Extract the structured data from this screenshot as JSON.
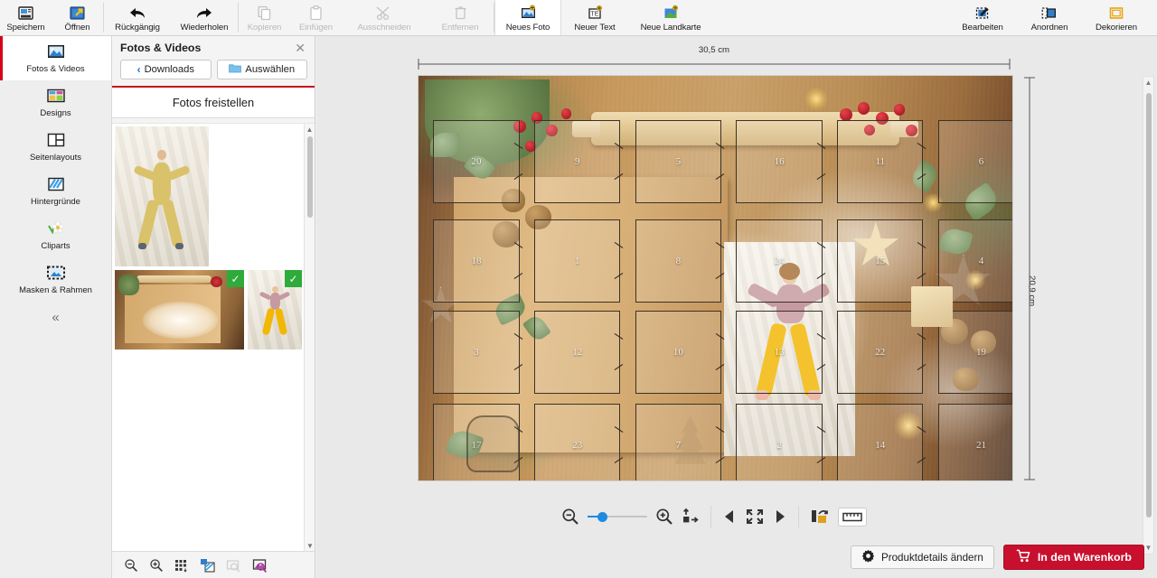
{
  "toolbar": {
    "groups": [
      {
        "items": [
          {
            "label": "Speichern",
            "icon": "save-icon",
            "state": "enabled"
          },
          {
            "label": "Öffnen",
            "icon": "open-folder-icon",
            "state": "enabled"
          }
        ]
      },
      {
        "items": [
          {
            "label": "Rückgängig",
            "icon": "undo-arrow-icon",
            "state": "enabled"
          },
          {
            "label": "Wiederholen",
            "icon": "redo-arrow-icon",
            "state": "enabled"
          }
        ]
      },
      {
        "items": [
          {
            "label": "Kopieren",
            "icon": "copy-icon",
            "state": "disabled"
          },
          {
            "label": "Einfügen",
            "icon": "paste-icon",
            "state": "disabled"
          },
          {
            "label": "Ausschneiden",
            "icon": "scissors-icon",
            "state": "disabled"
          },
          {
            "label": "Entfernen",
            "icon": "trash-icon",
            "state": "disabled"
          }
        ]
      },
      {
        "items": [
          {
            "label": "Neues Foto",
            "icon": "new-photo-icon",
            "state": "active"
          },
          {
            "label": "Neuer Text",
            "icon": "new-text-icon",
            "state": "enabled"
          },
          {
            "label": "Neue Landkarte",
            "icon": "new-map-icon",
            "state": "enabled"
          }
        ]
      },
      {
        "items": [
          {
            "label": "Bearbeiten",
            "icon": "edit-pencil-icon",
            "state": "enabled"
          },
          {
            "label": "Anordnen",
            "icon": "arrange-icon",
            "state": "enabled"
          },
          {
            "label": "Dekorieren",
            "icon": "decorate-frame-icon",
            "state": "enabled"
          }
        ]
      }
    ]
  },
  "sidebar": {
    "items": [
      {
        "label": "Fotos & Videos",
        "icon": "photo-icon",
        "selected": true
      },
      {
        "label": "Designs",
        "icon": "designs-grid-icon",
        "selected": false
      },
      {
        "label": "Seitenlayouts",
        "icon": "page-layout-icon",
        "selected": false
      },
      {
        "label": "Hintergründe",
        "icon": "backgrounds-icon",
        "selected": false
      },
      {
        "label": "Cliparts",
        "icon": "clipart-flower-icon",
        "selected": false
      },
      {
        "label": "Masken & Rahmen",
        "icon": "masks-frames-icon",
        "selected": false
      }
    ],
    "collapse_label": "«"
  },
  "panel": {
    "title": "Fotos & Videos",
    "close_label": "✕",
    "back_button": {
      "label": "Downloads",
      "chevron": "‹"
    },
    "select_button": {
      "label": "Auswählen",
      "icon": "folder-icon"
    },
    "cutout_button": "Fotos freistellen",
    "thumbnails": [
      {
        "name": "kid-on-bedsheet-portrait",
        "selected": true,
        "used": false
      },
      {
        "name": "baking-board-flour-landscape",
        "selected": false,
        "used": true
      },
      {
        "name": "girl-on-bedsheet-portrait",
        "selected": false,
        "used": true
      }
    ],
    "footer_tools": [
      {
        "icon": "zoom-out-icon"
      },
      {
        "icon": "zoom-in-icon"
      },
      {
        "icon": "grid-view-icon"
      },
      {
        "icon": "transparency-icon"
      },
      {
        "icon": "image-search-disabled-icon"
      },
      {
        "icon": "photo-search-icon"
      }
    ]
  },
  "canvas": {
    "width_label": "30,5 cm",
    "height_label": "20,9 cm",
    "doors": [
      [
        "20",
        "9",
        "5",
        "16",
        "11",
        "6"
      ],
      [
        "18",
        "1",
        "8",
        "24",
        "15",
        "4"
      ],
      [
        "3",
        "12",
        "10",
        "13",
        "22",
        "19"
      ],
      [
        "17",
        "23",
        "7",
        "2",
        "14",
        "21"
      ]
    ]
  },
  "zoombar": {
    "zoom_out": "zoom-out-icon",
    "zoom_in": "zoom-in-icon",
    "fit_icon": "fit-to-page-icon",
    "prev_page": "previous-page-icon",
    "full_view": "fullscreen-icon",
    "next_page": "next-page-icon",
    "swap_pages": "swap-pages-icon",
    "ruler": "ruler-icon",
    "zoom_value": "18"
  },
  "footer": {
    "product_details": {
      "label": "Produktdetails ändern",
      "icon": "gear-icon"
    },
    "add_to_cart": {
      "label": "In den Warenkorb",
      "icon": "cart-icon",
      "color": "#c8102e"
    }
  }
}
